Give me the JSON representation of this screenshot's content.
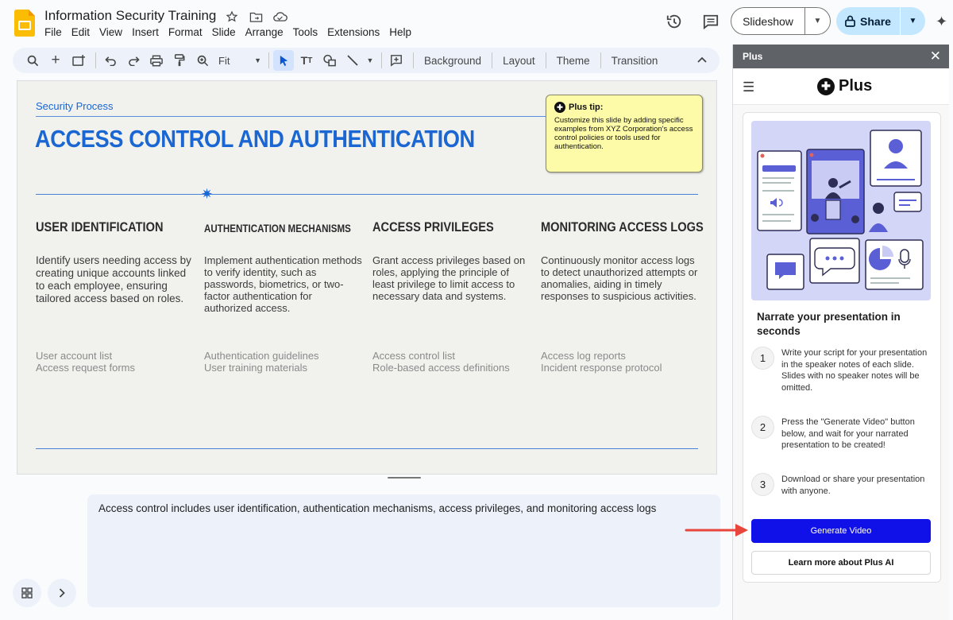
{
  "app": {
    "doc_title": "Information Security Training",
    "menu": [
      "File",
      "Edit",
      "View",
      "Insert",
      "Format",
      "Slide",
      "Arrange",
      "Tools",
      "Extensions",
      "Help"
    ]
  },
  "header": {
    "slideshow_label": "Slideshow",
    "share_label": "Share"
  },
  "toolbar": {
    "zoom_value": "Fit",
    "buttons": [
      "Background",
      "Layout",
      "Theme",
      "Transition"
    ]
  },
  "slide": {
    "kicker": "Security Process",
    "title": "ACCESS CONTROL AND AUTHENTICATION",
    "columns": [
      {
        "heading": "USER IDENTIFICATION",
        "body": "Identify users needing access by creating unique accounts linked to each employee, ensuring tailored access based on roles.",
        "refs": [
          "User account list",
          "Access request forms"
        ]
      },
      {
        "heading": "AUTHENTICATION MECHANISMS",
        "body": "Implement authentication methods to verify identity, such as passwords, biometrics, or two-factor authentication for authorized access.",
        "refs": [
          "Authentication guidelines",
          "User training materials"
        ]
      },
      {
        "heading": "ACCESS PRIVILEGES",
        "body": "Grant access privileges based on roles, applying the principle of least privilege to limit access to necessary data and systems.",
        "refs": [
          "Access control list",
          "Role-based access definitions"
        ]
      },
      {
        "heading": "MONITORING ACCESS LOGS",
        "body": "Continuously monitor access logs to detect unauthorized attempts or anomalies, aiding in timely responses to suspicious activities.",
        "refs": [
          "Access log reports",
          "Incident response protocol"
        ]
      }
    ],
    "tip": {
      "label": "Plus tip:",
      "text": "Customize this slide by adding specific examples from XYZ Corporation's access control policies or tools used for authentication."
    }
  },
  "notes": {
    "text": "Access control includes user identification, authentication mechanisms, access privileges, and monitoring access logs"
  },
  "panel": {
    "title": "Plus",
    "brand": "Plus",
    "heading": "Narrate your presentation in seconds",
    "steps": [
      {
        "num": "1",
        "text": "Write your script for your presentation in the speaker notes of each slide. Slides with no speaker notes will be omitted."
      },
      {
        "num": "2",
        "text": "Press the \"Generate Video\" button below, and wait for your narrated presentation to be created!"
      },
      {
        "num": "3",
        "text": "Download or share your presentation with anyone."
      }
    ],
    "generate_label": "Generate Video",
    "learn_label": "Learn more about Plus AI"
  },
  "colors": {
    "accent_blue": "#1a66d2",
    "generate_button": "#1010e8",
    "annotation_arrow": "#e8453c",
    "tip_background": "#fdfba8",
    "illustration_bg": "#d4d6f7"
  },
  "icons": [
    "slides-logo-icon",
    "star-icon",
    "move-to-folder-icon",
    "cloud-status-icon",
    "history-icon",
    "comment-icon",
    "lock-icon",
    "gemini-sparkle-icon",
    "search-menus-icon",
    "new-slide-icon",
    "undo-icon",
    "redo-icon",
    "print-icon",
    "paint-format-icon",
    "zoom-icon",
    "select-icon",
    "text-box-icon",
    "shape-icon",
    "line-icon",
    "add-comment-icon",
    "grid-view-icon",
    "chevron-right-icon",
    "close-icon",
    "hamburger-menu-icon",
    "plus-logo-icon"
  ]
}
